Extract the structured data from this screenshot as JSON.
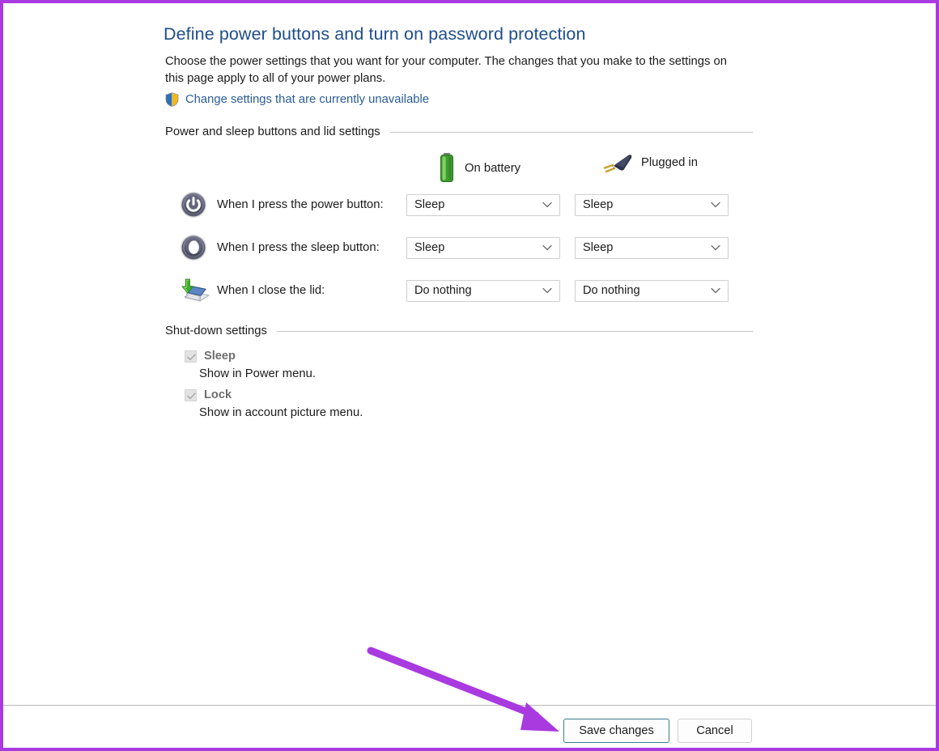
{
  "header": {
    "title": "Define power buttons and turn on password protection",
    "description": "Choose the power settings that you want for your computer. The changes that you make to the settings on this page apply to all of your power plans.",
    "uac_link": "Change settings that are currently unavailable",
    "shield_icon": "shield-icon"
  },
  "power_section": {
    "group_label": "Power and sleep buttons and lid settings",
    "columns": [
      {
        "label": "On battery",
        "icon": "battery-icon"
      },
      {
        "label": "Plugged in",
        "icon": "power-plug-icon"
      }
    ],
    "rows": [
      {
        "icon": "power-button-icon",
        "label": "When I press the power button:",
        "on_battery": "Sleep",
        "plugged_in": "Sleep"
      },
      {
        "icon": "sleep-button-icon",
        "label": "When I press the sleep button:",
        "on_battery": "Sleep",
        "plugged_in": "Sleep"
      },
      {
        "icon": "laptop-lid-icon",
        "label": "When I close the lid:",
        "on_battery": "Do nothing",
        "plugged_in": "Do nothing"
      }
    ]
  },
  "shutdown_section": {
    "group_label": "Shut-down settings",
    "options": [
      {
        "title": "Sleep",
        "description": "Show in Power menu.",
        "checked": true,
        "disabled": true
      },
      {
        "title": "Lock",
        "description": "Show in account picture menu.",
        "checked": true,
        "disabled": true
      }
    ]
  },
  "footer": {
    "save_label": "Save changes",
    "cancel_label": "Cancel"
  },
  "annotation": {
    "arrow_color": "#a83ae0",
    "border_color": "#a83ae0"
  },
  "colors": {
    "title_blue": "#1f4e8c",
    "link_blue": "#2a5c96",
    "text": "#1b1b1b",
    "rule": "#c8c8c8",
    "default_button_border": "#3a7c8c"
  }
}
